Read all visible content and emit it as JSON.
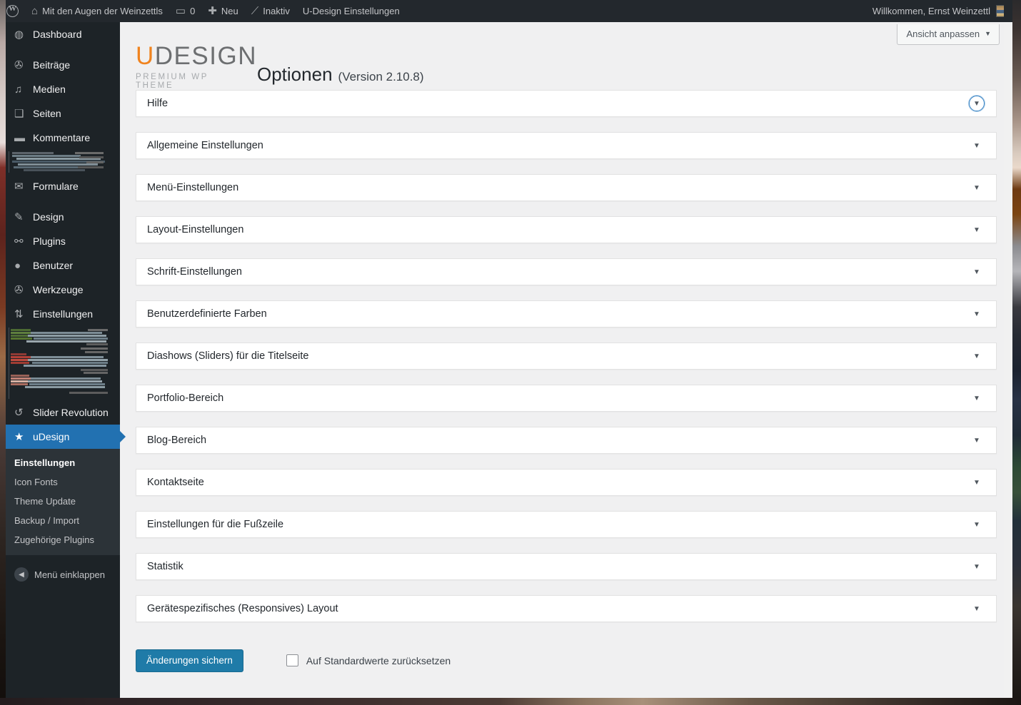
{
  "adminbar": {
    "wp_logo": "wordpress-logo",
    "site_name": "Mit den Augen der Weinzettls",
    "comments_count": "0",
    "new_label": "Neu",
    "inaktiv_label": "Inaktiv",
    "udesign_label": "U-Design Einstellungen",
    "welcome": "Willkommen, Ernst Weinzettl"
  },
  "sidebar": {
    "items": [
      {
        "label": "Dashboard",
        "icon": "dashboard-icon",
        "glyph": "◍"
      },
      {
        "label": "Beiträge",
        "icon": "pin-icon",
        "glyph": "✇"
      },
      {
        "label": "Medien",
        "icon": "media-icon",
        "glyph": "♫"
      },
      {
        "label": "Seiten",
        "icon": "pages-icon",
        "glyph": "❑"
      },
      {
        "label": "Kommentare",
        "icon": "comment-icon",
        "glyph": "▬"
      },
      {
        "label": "Formulare",
        "icon": "envelope-icon",
        "glyph": "✉"
      },
      {
        "label": "Design",
        "icon": "brush-icon",
        "glyph": "✎"
      },
      {
        "label": "Plugins",
        "icon": "plug-icon",
        "glyph": "⚯"
      },
      {
        "label": "Benutzer",
        "icon": "user-icon",
        "glyph": "●"
      },
      {
        "label": "Werkzeuge",
        "icon": "wrench-icon",
        "glyph": "✇"
      },
      {
        "label": "Einstellungen",
        "icon": "sliders-icon",
        "glyph": "⇅"
      },
      {
        "label": "Slider Revolution",
        "icon": "refresh-icon",
        "glyph": "↺"
      }
    ],
    "current": {
      "label": "uDesign",
      "icon": "star-icon",
      "glyph": "★"
    },
    "submenu": [
      {
        "label": "Einstellungen",
        "active": true
      },
      {
        "label": "Icon Fonts",
        "active": false
      },
      {
        "label": "Theme Update",
        "active": false
      },
      {
        "label": "Backup / Import",
        "active": false
      },
      {
        "label": "Zugehörige Plugins",
        "active": false
      }
    ],
    "collapse": "Menü einklappen"
  },
  "header": {
    "view_toggle": "Ansicht anpassen",
    "logo_u": "U",
    "logo_rest": "DESIGN",
    "logo_sub": "PREMIUM WP THEME",
    "title": "Optionen",
    "version": "(Version 2.10.8)"
  },
  "panels": [
    {
      "label": "Hilfe",
      "focused": true
    },
    {
      "label": "Allgemeine Einstellungen",
      "focused": false
    },
    {
      "label": "Menü-Einstellungen",
      "focused": false
    },
    {
      "label": "Layout-Einstellungen",
      "focused": false
    },
    {
      "label": "Schrift-Einstellungen",
      "focused": false
    },
    {
      "label": "Benutzerdefinierte Farben",
      "focused": false
    },
    {
      "label": "Diashows (Sliders) für die Titelseite",
      "focused": false
    },
    {
      "label": "Portfolio-Bereich",
      "focused": false
    },
    {
      "label": "Blog-Bereich",
      "focused": false
    },
    {
      "label": "Kontaktseite",
      "focused": false
    },
    {
      "label": "Einstellungen für die Fußzeile",
      "focused": false
    },
    {
      "label": "Statistik",
      "focused": false
    },
    {
      "label": "Gerätespezifisches (Responsives) Layout",
      "focused": false
    }
  ],
  "actions": {
    "save_label": "Änderungen sichern",
    "reset_label": "Auf Standardwerte zurücksetzen",
    "reset_checked": false
  },
  "colors": {
    "admin_bar": "#23282d",
    "sidebar": "#1d2327",
    "accent_blue": "#2271b1",
    "save_blue": "#1f7ba8",
    "logo_orange": "#f0831e",
    "content_bg": "#f0f0f1",
    "panel_bg": "#ffffff"
  }
}
